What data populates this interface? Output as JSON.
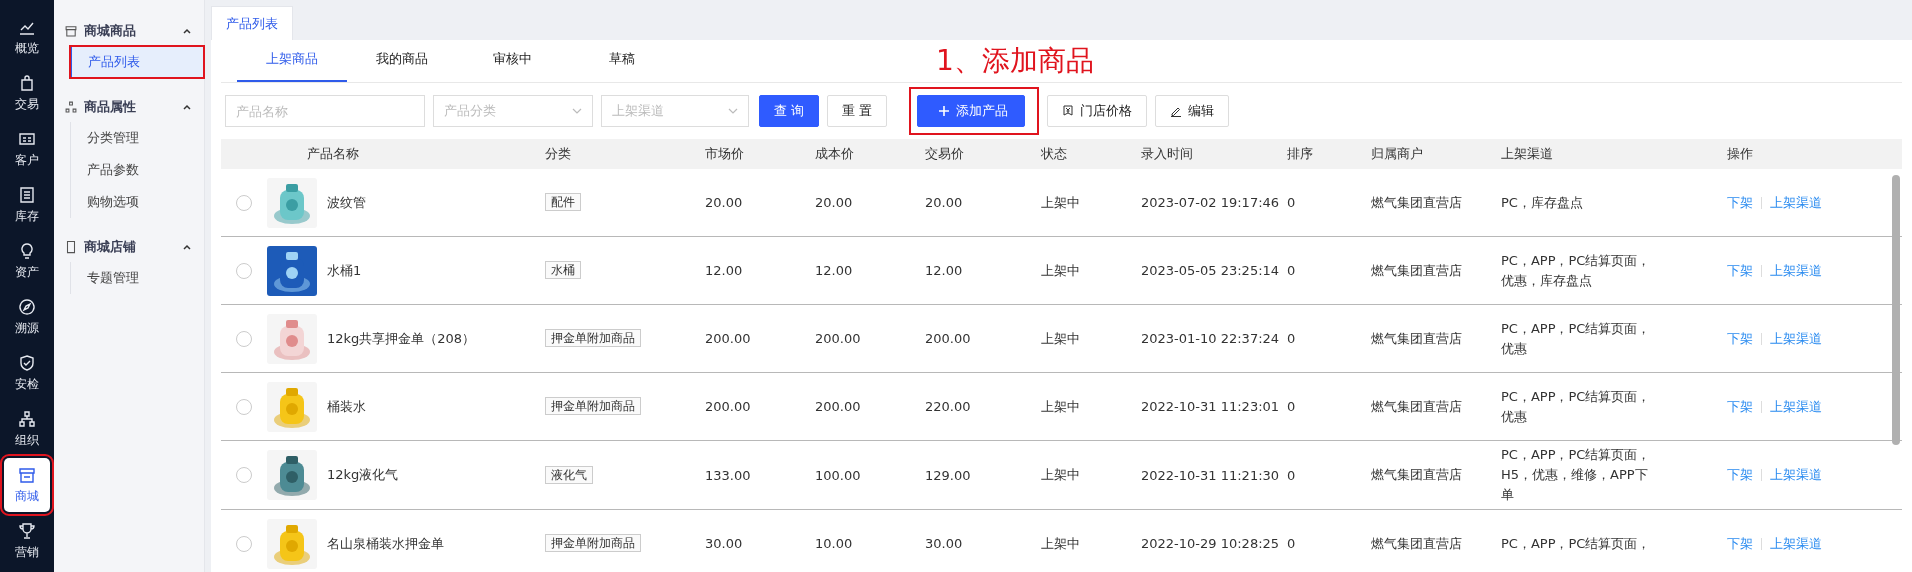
{
  "nav": [
    {
      "label": "概览",
      "selected": false,
      "highlighted": false
    },
    {
      "label": "交易",
      "selected": false,
      "highlighted": false
    },
    {
      "label": "客户",
      "selected": false,
      "highlighted": false
    },
    {
      "label": "库存",
      "selected": false,
      "highlighted": false
    },
    {
      "label": "资产",
      "selected": false,
      "highlighted": false
    },
    {
      "label": "溯源",
      "selected": false,
      "highlighted": false
    },
    {
      "label": "安检",
      "selected": false,
      "highlighted": false
    },
    {
      "label": "组织",
      "selected": false,
      "highlighted": false
    },
    {
      "label": "商城",
      "selected": true,
      "highlighted": true
    },
    {
      "label": "营销",
      "selected": false,
      "highlighted": false
    }
  ],
  "sidebar": {
    "groups": [
      {
        "label": "商城商品",
        "expanded": true,
        "items": [
          {
            "label": "产品列表",
            "selected": true,
            "highlighted": true
          }
        ]
      },
      {
        "label": "商品属性",
        "expanded": true,
        "items": [
          {
            "label": "分类管理",
            "selected": false,
            "highlighted": false
          },
          {
            "label": "产品参数",
            "selected": false,
            "highlighted": false
          },
          {
            "label": "购物选项",
            "selected": false,
            "highlighted": false
          }
        ]
      },
      {
        "label": "商城店铺",
        "expanded": true,
        "items": [
          {
            "label": "专题管理",
            "selected": false,
            "highlighted": false
          }
        ]
      }
    ]
  },
  "page_tabs": [
    {
      "label": "产品列表",
      "selected": true
    }
  ],
  "tabs": [
    {
      "label": "上架商品",
      "selected": true
    },
    {
      "label": "我的商品",
      "selected": false
    },
    {
      "label": "审核中",
      "selected": false
    },
    {
      "label": "草稿",
      "selected": false
    }
  ],
  "annotation": {
    "text": "1、添加商品"
  },
  "filters": {
    "name": {
      "placeholder": "产品名称"
    },
    "category": {
      "placeholder": "产品分类"
    },
    "channel": {
      "placeholder": "上架渠道"
    }
  },
  "buttons": [
    {
      "label": "查 询",
      "kind": "primary",
      "highlighted": false
    },
    {
      "label": "重 置",
      "kind": "plain",
      "highlighted": false
    },
    {
      "label": "添加产品",
      "kind": "add",
      "highlighted": true
    },
    {
      "label": "门店价格",
      "kind": "price",
      "highlighted": false
    },
    {
      "label": "编辑",
      "kind": "edit",
      "highlighted": false
    }
  ],
  "table": {
    "columns": [
      "产品名称",
      "分类",
      "市场价",
      "成本价",
      "交易价",
      "状态",
      "录入时间",
      "排序",
      "归属商户",
      "上架渠道",
      "操作"
    ],
    "rows": [
      {
        "selected": false,
        "name": "波纹管",
        "category": "配件",
        "market": "20.00",
        "cost": "20.00",
        "trade": "20.00",
        "status": "上架中",
        "time": "2023-07-02 19:17:46",
        "sort": "0",
        "merchant": "燃气集团直营店",
        "channels": "PC，库存盘点",
        "actions": [
          "下架",
          "上架渠道"
        ]
      },
      {
        "selected": false,
        "name": "水桶1",
        "category": "水桶",
        "market": "12.00",
        "cost": "12.00",
        "trade": "12.00",
        "status": "上架中",
        "time": "2023-05-05 23:25:14",
        "sort": "0",
        "merchant": "燃气集团直营店",
        "channels": "PC，APP，PC结算页面，优惠，库存盘点",
        "actions": [
          "下架",
          "上架渠道"
        ]
      },
      {
        "selected": false,
        "name": "12kg共享押金单（208）",
        "category": "押金单附加商品",
        "market": "200.00",
        "cost": "200.00",
        "trade": "200.00",
        "status": "上架中",
        "time": "2023-01-10 22:37:24",
        "sort": "0",
        "merchant": "燃气集团直营店",
        "channels": "PC，APP，PC结算页面，优惠",
        "actions": [
          "下架",
          "上架渠道"
        ]
      },
      {
        "selected": false,
        "name": "桶装水",
        "category": "押金单附加商品",
        "market": "200.00",
        "cost": "200.00",
        "trade": "220.00",
        "status": "上架中",
        "time": "2022-10-31 11:23:01",
        "sort": "0",
        "merchant": "燃气集团直营店",
        "channels": "PC，APP，PC结算页面，优惠",
        "actions": [
          "下架",
          "上架渠道"
        ]
      },
      {
        "selected": false,
        "name": "12kg液化气",
        "category": "液化气",
        "market": "133.00",
        "cost": "100.00",
        "trade": "129.00",
        "status": "上架中",
        "time": "2022-10-31 11:21:30",
        "sort": "0",
        "merchant": "燃气集团直营店",
        "channels": "PC，APP，PC结算页面，H5，优惠，维修，APP下单",
        "actions": [
          "下架",
          "上架渠道"
        ]
      },
      {
        "selected": false,
        "name": "名山泉桶装水押金单",
        "category": "押金单附加商品",
        "market": "30.00",
        "cost": "10.00",
        "trade": "30.00",
        "status": "上架中",
        "time": "2022-10-29 10:28:25",
        "sort": "0",
        "merchant": "燃气集团直营店",
        "channels": "PC，APP，PC结算页面，",
        "actions": [
          "下架",
          "上架渠道"
        ]
      }
    ]
  }
}
